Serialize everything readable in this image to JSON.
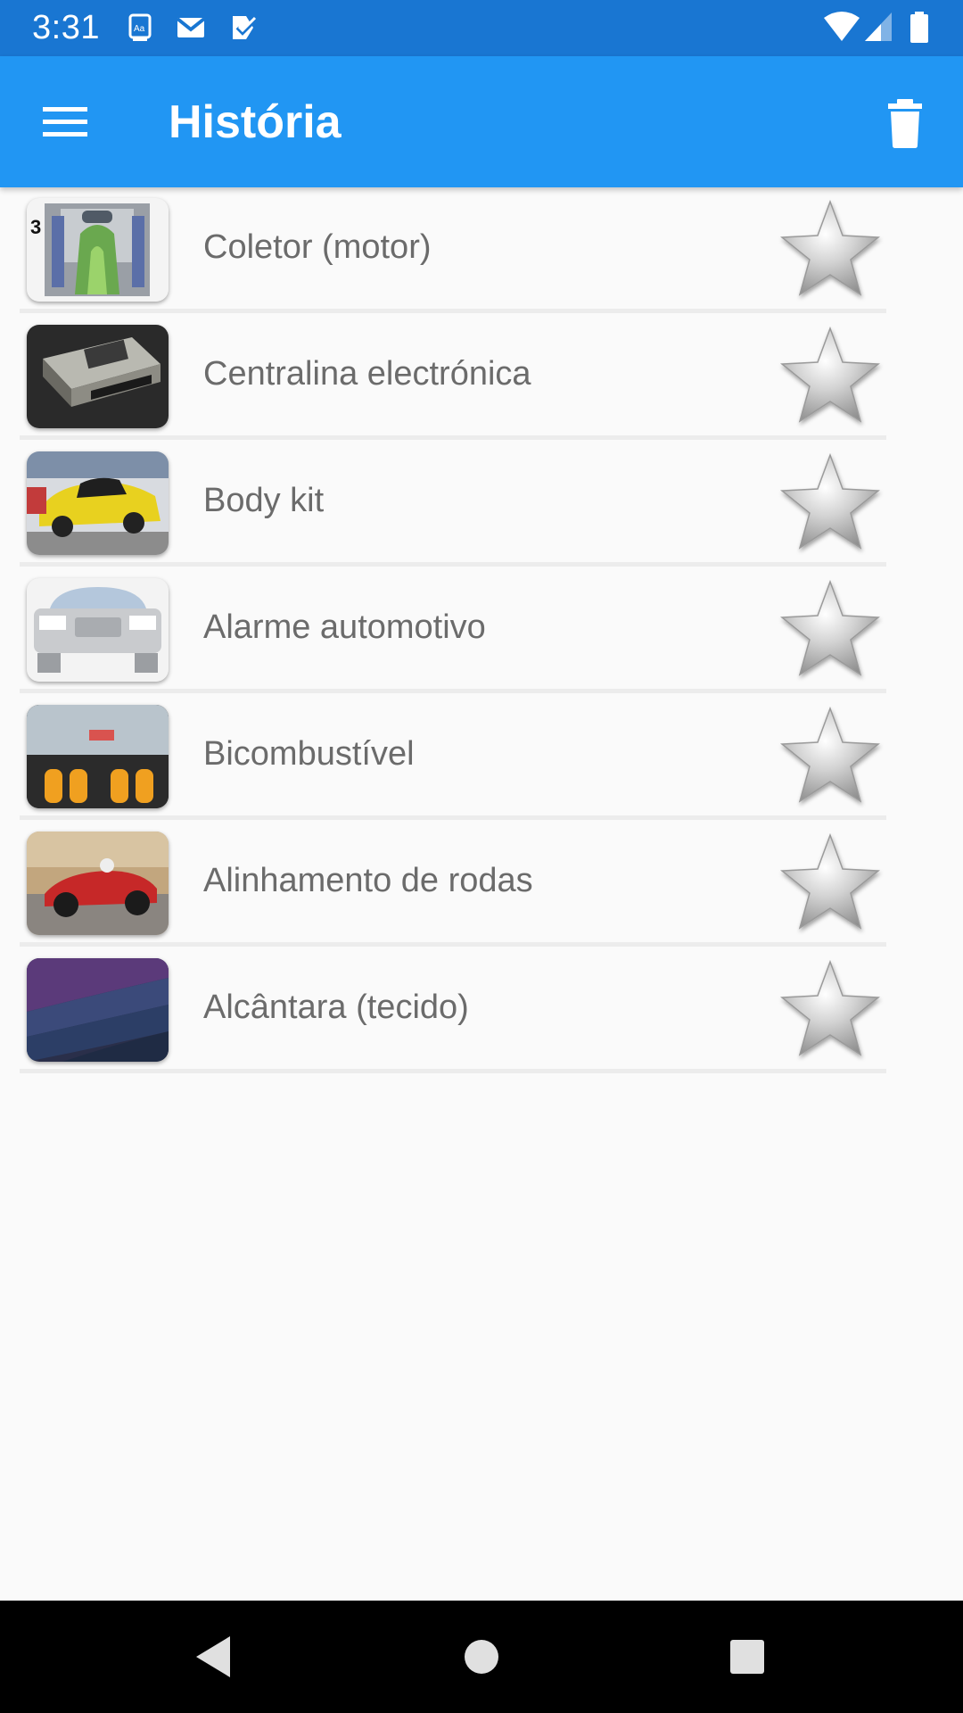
{
  "status_bar": {
    "time": "3:31",
    "icons": [
      "dictionary-icon",
      "gmail-icon",
      "task-check-icon"
    ],
    "right_icons": [
      "wifi-icon",
      "signal-icon",
      "battery-icon"
    ]
  },
  "app_bar": {
    "title": "História",
    "menu_icon": "hamburger-menu-icon",
    "action_icon": "trash-icon",
    "color": "#2196f3"
  },
  "history": {
    "items": [
      {
        "label": "Coletor (motor)",
        "thumb": "intake-manifold-diagram",
        "favorite": false
      },
      {
        "label": "Centralina electrónica",
        "thumb": "engine-control-unit-photo",
        "favorite": false
      },
      {
        "label": "Body kit",
        "thumb": "yellow-tuned-car-photo",
        "favorite": false
      },
      {
        "label": "Alarme automotivo",
        "thumb": "car-rear-illustration",
        "favorite": false
      },
      {
        "label": "Bicombustível",
        "thumb": "car-trunk-gas-cylinders-photo",
        "favorite": false
      },
      {
        "label": "Alinhamento de rodas",
        "thumb": "red-race-car-photo",
        "favorite": false
      },
      {
        "label": "Alcântara (tecido)",
        "thumb": "fabric-swatches-photo",
        "favorite": false
      }
    ]
  },
  "nav_bar": {
    "buttons": [
      "back-icon",
      "home-icon",
      "recents-icon"
    ]
  }
}
